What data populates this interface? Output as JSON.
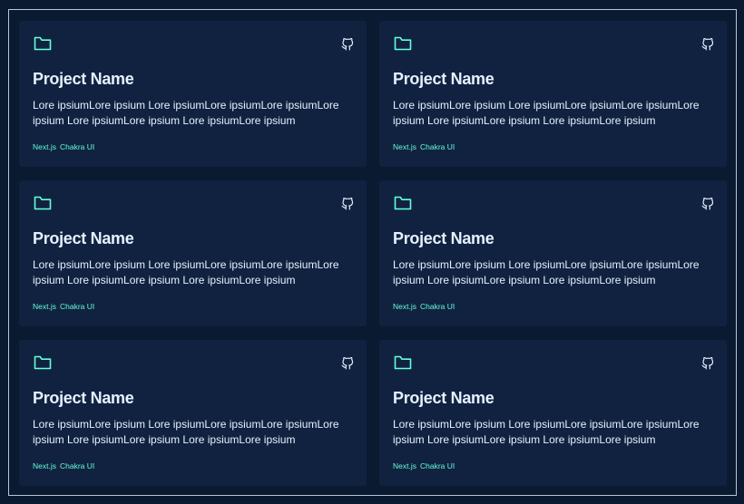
{
  "colors": {
    "background": "#0a1a30",
    "card": "#112240",
    "accent": "#64ffda",
    "text": "#e6f1ff"
  },
  "projects": [
    {
      "icon": "folder-icon",
      "link_icon": "github-icon",
      "title": "Project Name",
      "description": "Lore ipsiumLore ipsium Lore ipsiumLore ipsiumLore ipsiumLore ipsium Lore ipsiumLore ipsium Lore ipsiumLore ipsium",
      "tags": [
        "Next.js",
        "Chakra UI"
      ]
    },
    {
      "icon": "folder-icon",
      "link_icon": "github-icon",
      "title": "Project Name",
      "description": "Lore ipsiumLore ipsium Lore ipsiumLore ipsiumLore ipsiumLore ipsium Lore ipsiumLore ipsium Lore ipsiumLore ipsium",
      "tags": [
        "Next.js",
        "Chakra UI"
      ]
    },
    {
      "icon": "folder-icon",
      "link_icon": "github-icon",
      "title": "Project Name",
      "description": "Lore ipsiumLore ipsium Lore ipsiumLore ipsiumLore ipsiumLore ipsium Lore ipsiumLore ipsium Lore ipsiumLore ipsium",
      "tags": [
        "Next.js",
        "Chakra UI"
      ]
    },
    {
      "icon": "folder-icon",
      "link_icon": "github-icon",
      "title": "Project Name",
      "description": "Lore ipsiumLore ipsium Lore ipsiumLore ipsiumLore ipsiumLore ipsium Lore ipsiumLore ipsium Lore ipsiumLore ipsium",
      "tags": [
        "Next.js",
        "Chakra UI"
      ]
    },
    {
      "icon": "folder-icon",
      "link_icon": "github-icon",
      "title": "Project Name",
      "description": "Lore ipsiumLore ipsium Lore ipsiumLore ipsiumLore ipsiumLore ipsium Lore ipsiumLore ipsium Lore ipsiumLore ipsium",
      "tags": [
        "Next.js",
        "Chakra UI"
      ]
    },
    {
      "icon": "folder-icon",
      "link_icon": "github-icon",
      "title": "Project Name",
      "description": "Lore ipsiumLore ipsium Lore ipsiumLore ipsiumLore ipsiumLore ipsium Lore ipsiumLore ipsium Lore ipsiumLore ipsium",
      "tags": [
        "Next.js",
        "Chakra UI"
      ]
    }
  ]
}
